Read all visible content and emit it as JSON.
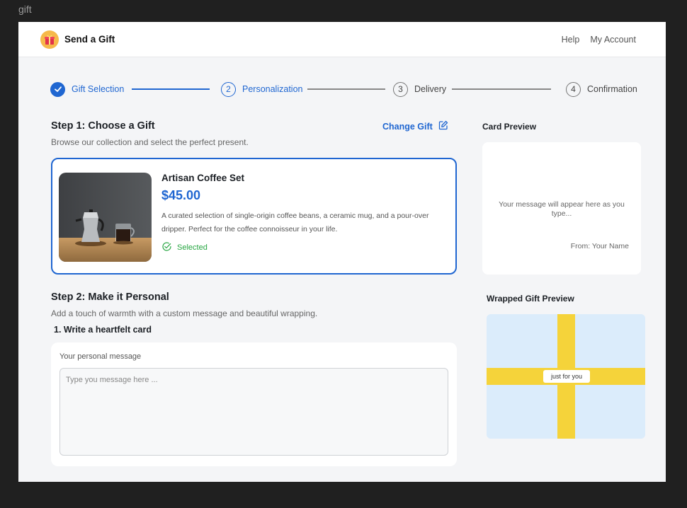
{
  "window": {
    "title": "gift"
  },
  "header": {
    "brand": "Send a Gift",
    "nav": {
      "help": "Help",
      "account": "My Account"
    }
  },
  "stepper": [
    {
      "number": "1",
      "label": "Gift Selection",
      "state": "done"
    },
    {
      "number": "2",
      "label": "Personalization",
      "state": "current"
    },
    {
      "number": "3",
      "label": "Delivery",
      "state": "todo"
    },
    {
      "number": "4",
      "label": "Confirmation",
      "state": "todo"
    }
  ],
  "step1": {
    "title": "Step 1: Choose a Gift",
    "subtitle": "Browse our collection and select the perfect present.",
    "change_label": "Change Gift",
    "gift": {
      "name": "Artisan Coffee Set",
      "price": "$45.00",
      "description": "A curated selection of single-origin coffee beans, a ceramic mug, and a pour-over dripper. Perfect for the coffee connoisseur in your life.",
      "status": "Selected"
    }
  },
  "step2": {
    "title": "Step 2: Make it Personal",
    "subtitle": "Add a touch of warmth with a custom message and beautiful wrapping.",
    "card_section_title": "1. Write a heartfelt card",
    "message_label": "Your personal message",
    "message_placeholder": "Type you message here ...",
    "message_value": ""
  },
  "card_preview": {
    "title": "Card Preview",
    "message": "Your message will appear here as you type...",
    "from": "From: Your Name"
  },
  "wrap_preview": {
    "title": "Wrapped Gift Preview",
    "tag": "just for you"
  },
  "colors": {
    "accent": "#1f66d1",
    "success": "#27a642",
    "ribbon": "#f5d33a",
    "wrap_paper": "#dbecfb"
  }
}
